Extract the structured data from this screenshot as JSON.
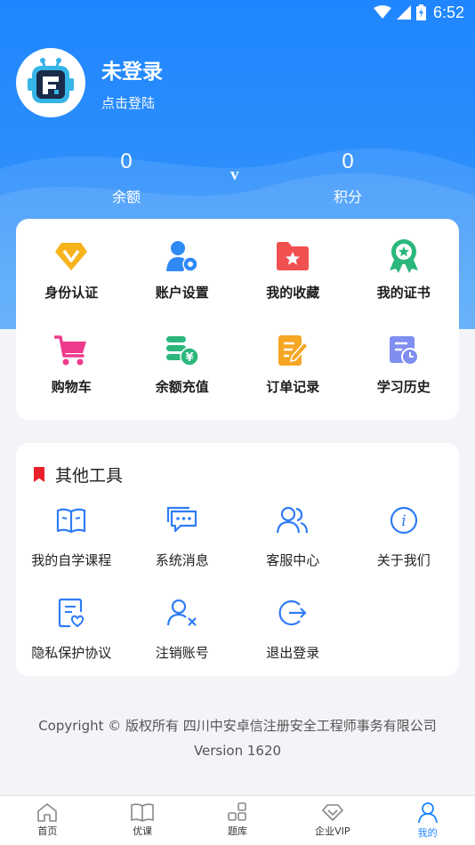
{
  "status_bar": {
    "time": "6:52"
  },
  "profile": {
    "name": "未登录",
    "subtitle": "点击登陆"
  },
  "stats": {
    "balance": {
      "value": "0",
      "label": "余额"
    },
    "points": {
      "value": "0",
      "label": "积分"
    },
    "vip_mark": "v"
  },
  "menu": {
    "items": [
      {
        "label": "身份认证",
        "icon": "diamond-icon"
      },
      {
        "label": "账户设置",
        "icon": "user-gear-icon"
      },
      {
        "label": "我的收藏",
        "icon": "folder-star-icon"
      },
      {
        "label": "我的证书",
        "icon": "award-icon"
      },
      {
        "label": "购物车",
        "icon": "cart-icon"
      },
      {
        "label": "余额充值",
        "icon": "coin-stack-icon"
      },
      {
        "label": "订单记录",
        "icon": "order-edit-icon"
      },
      {
        "label": "学习历史",
        "icon": "history-clock-icon"
      }
    ]
  },
  "tools": {
    "title": "其他工具",
    "items": [
      {
        "label": "我的自学课程",
        "icon": "book-icon"
      },
      {
        "label": "系统消息",
        "icon": "message-icon"
      },
      {
        "label": "客服中心",
        "icon": "users-icon"
      },
      {
        "label": "关于我们",
        "icon": "info-icon"
      },
      {
        "label": "隐私保护协议",
        "icon": "privacy-doc-icon"
      },
      {
        "label": "注销账号",
        "icon": "user-remove-icon"
      },
      {
        "label": "退出登录",
        "icon": "logout-icon"
      }
    ]
  },
  "footer": {
    "copyright": "Copyright © 版权所有 四川中安卓信注册安全工程师事务有限公司",
    "version": "Version 1620"
  },
  "tabbar": {
    "tabs": [
      {
        "label": "首页",
        "icon": "home-icon"
      },
      {
        "label": "优课",
        "icon": "book-open-icon"
      },
      {
        "label": "题库",
        "icon": "grid-icon"
      },
      {
        "label": "企业VIP",
        "icon": "diamond-outline-icon"
      },
      {
        "label": "我的",
        "icon": "person-icon"
      }
    ]
  },
  "colors": {
    "primary": "#1f86ff",
    "bookmark": "#e8202a"
  }
}
